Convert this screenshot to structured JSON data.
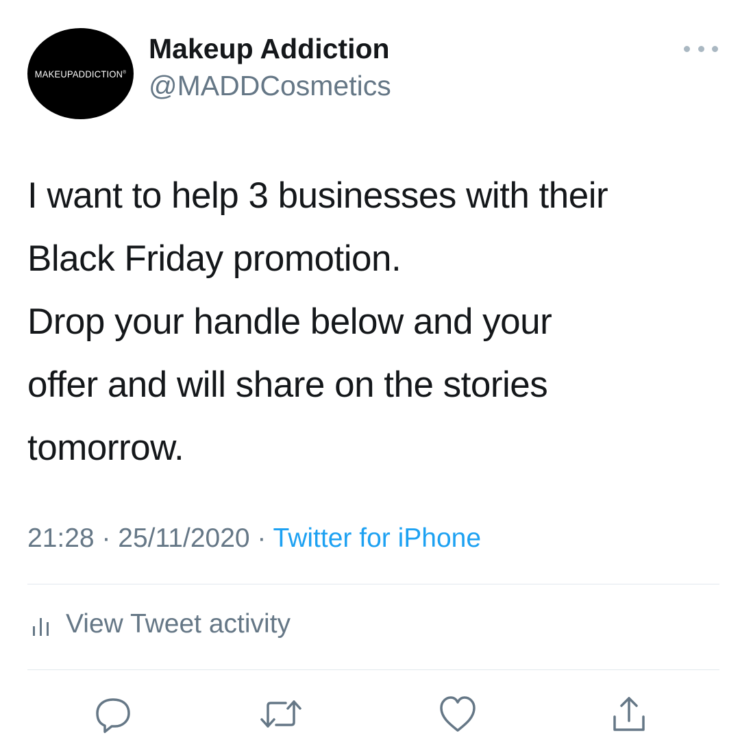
{
  "author": {
    "avatar_text": "MAKEUPADDICTION",
    "avatar_mark": "®",
    "display_name": "Makeup Addiction",
    "handle": "@MADDCosmetics"
  },
  "tweet": {
    "lines": [
      "I want to help 3 businesses with their",
      "Black Friday promotion.",
      "Drop your handle below and your",
      "offer and will share on the stories",
      "tomorrow."
    ],
    "time": "21:28",
    "separator": " · ",
    "date": "25/11/2020",
    "source": "Twitter for iPhone"
  },
  "activity": {
    "label": "View Tweet activity",
    "icon": "analytics-bars-icon"
  },
  "actions": {
    "reply_icon": "reply-icon",
    "retweet_icon": "retweet-icon",
    "like_icon": "like-icon",
    "share_icon": "share-icon"
  },
  "colors": {
    "text": "#14171a",
    "secondary": "#657786",
    "link": "#1da1f2",
    "divider": "#e1e8ed"
  }
}
